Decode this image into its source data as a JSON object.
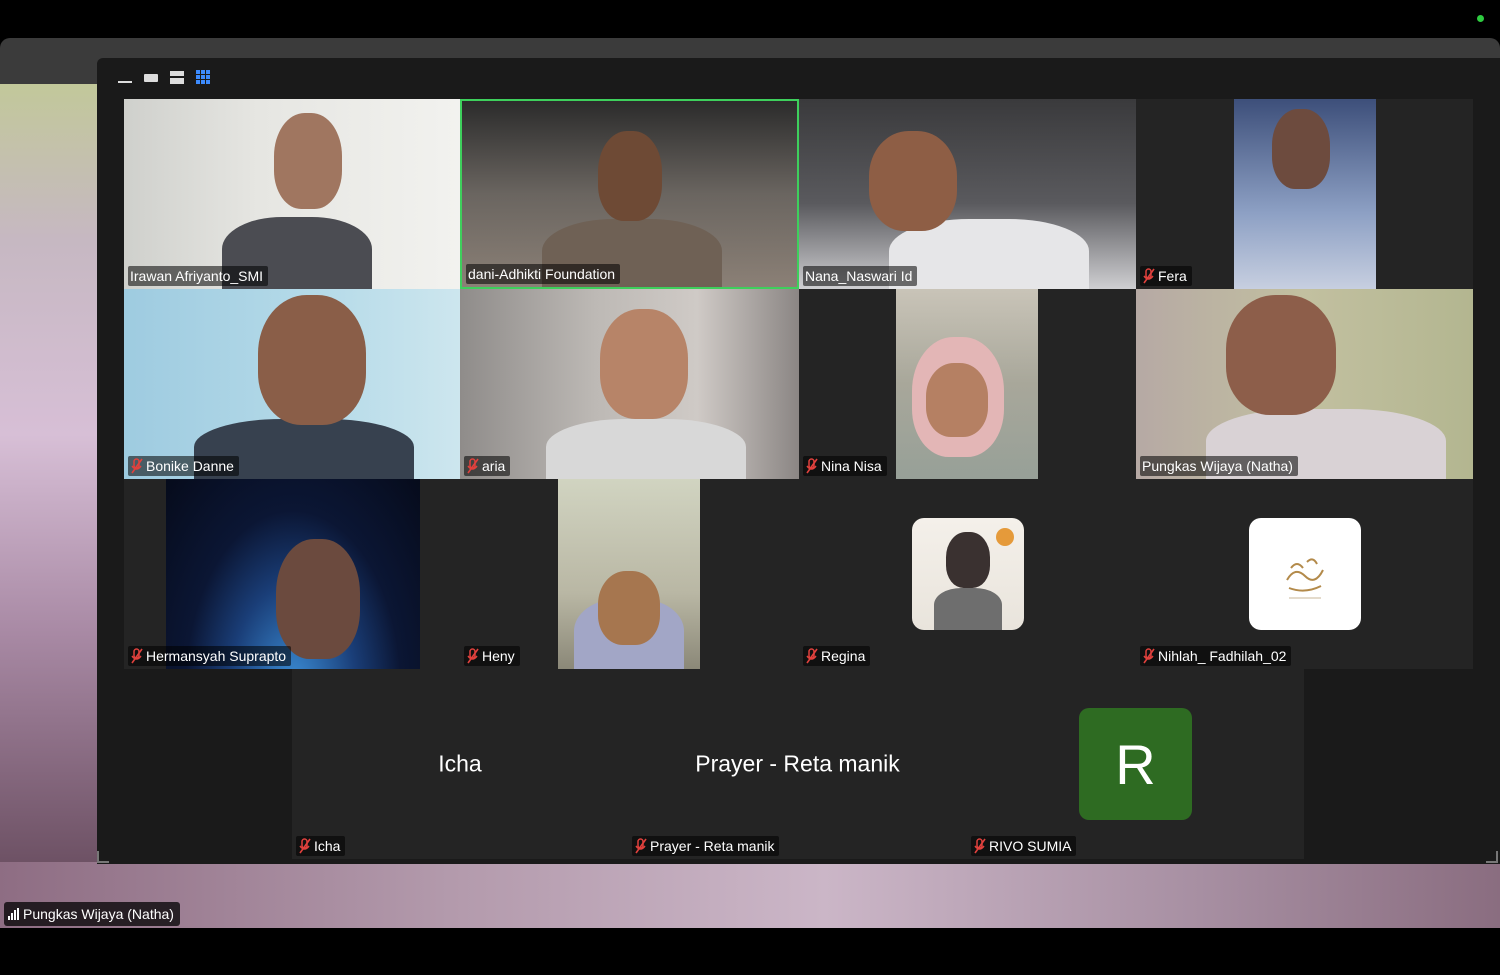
{
  "self_view": {
    "name": "Pungkas Wijaya (Natha)"
  },
  "gallery": {
    "view_options": [
      "minimize-view",
      "speaker-view",
      "strip-view",
      "gallery-view"
    ],
    "tiles": [
      {
        "name": "Irawan Afriyanto_SMI",
        "muted": false
      },
      {
        "name": "dani-Adhikti Foundation",
        "muted": false,
        "active_speaker": true
      },
      {
        "name": "Nana_Naswari Id",
        "muted": false
      },
      {
        "name": "Fera",
        "muted": true
      },
      {
        "name": "Bonike Danne",
        "muted": true
      },
      {
        "name": "aria",
        "muted": true
      },
      {
        "name": "Nina Nisa",
        "muted": true
      },
      {
        "name": "Pungkas Wijaya (Natha)",
        "muted": false
      },
      {
        "name": "Hermansyah Suprapto",
        "muted": true
      },
      {
        "name": "Heny",
        "muted": true
      },
      {
        "name": "Regina",
        "muted": true
      },
      {
        "name": "Nihlah_ Fadhilah_02",
        "muted": true
      },
      {
        "name": "Icha",
        "muted": true,
        "display_text": "Icha"
      },
      {
        "name": "Prayer - Reta manik",
        "muted": true,
        "display_text": "Prayer - Reta manik"
      },
      {
        "name": "RIVO SUMIA",
        "muted": true,
        "avatar_letter": "R"
      }
    ]
  },
  "colors": {
    "active_speaker_border": "#3ecf5c",
    "mute_icon": "#e0413d",
    "avatar_bg": "#2e6b22",
    "grid_icon": "#3d8bfd"
  }
}
